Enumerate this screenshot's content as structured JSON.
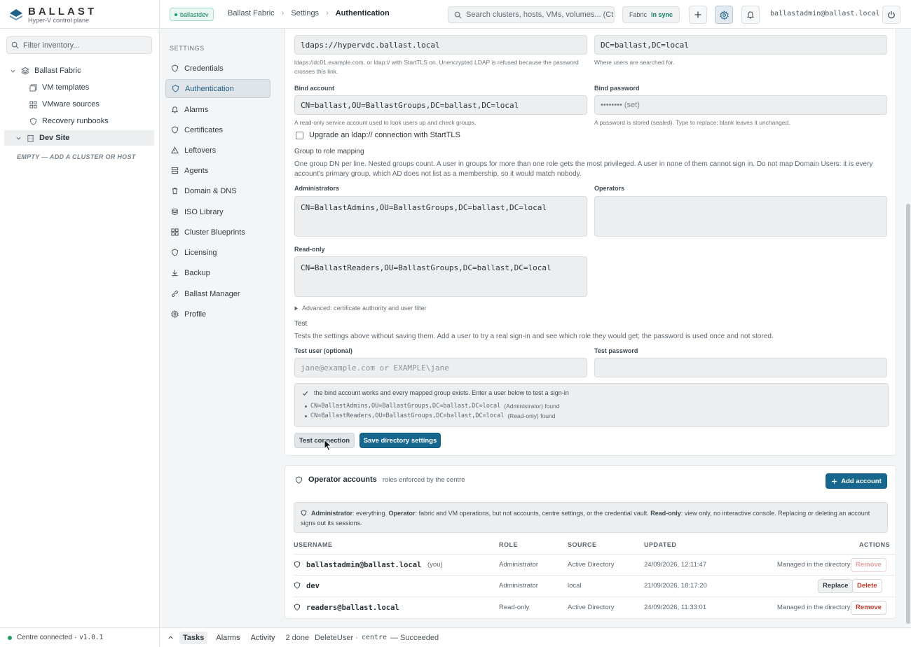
{
  "brand": {
    "name": "BALLAST",
    "subtitle": "Hyper-V control plane"
  },
  "inventory": {
    "filter_placeholder": "Filter inventory...",
    "tree": {
      "fabric": "Ballast Fabric",
      "vm_templates": "VM templates",
      "vmware_sources": "VMware sources",
      "recovery_runbooks": "Recovery runbooks",
      "dev_site": "Dev Site",
      "empty_hint": "EMPTY — ADD A CLUSTER OR HOST"
    },
    "footer": {
      "status": "Centre connected ·",
      "version": "v1.0.1"
    }
  },
  "topbar": {
    "site_badge": "ballastdev",
    "breadcrumb": [
      "Ballast Fabric",
      "Settings",
      "Authentication"
    ],
    "breadcrumb_sep": "›",
    "search_placeholder": "Search clusters, hosts, VMs, volumes... (Ctrl-K)",
    "fabric_label": "Fabric",
    "fabric_status": "In sync",
    "user": "ballastadmin@ballast.local"
  },
  "settings_nav": {
    "heading": "SETTINGS",
    "items": [
      "Credentials",
      "Authentication",
      "Alarms",
      "Certificates",
      "Leftovers",
      "Agents",
      "Domain & DNS",
      "ISO Library",
      "Cluster Blueprints",
      "Licensing",
      "Backup",
      "Ballast Manager",
      "Profile"
    ],
    "active": "Authentication"
  },
  "directory": {
    "server_value": "ldaps://hypervdc.ballast.local",
    "server_help": "ldaps://dc01.example.com, or ldap:// with StartTLS on. Unencrypted LDAP is refused because the password crosses this link.",
    "base_value": "DC=ballast,DC=local",
    "base_help": "Where users are searched for.",
    "bind_account_label": "Bind account",
    "bind_account_value": "CN=ballast,OU=BallastGroups,DC=ballast,DC=local",
    "bind_account_help": "A read-only service account used to look users up and check groups.",
    "bind_password_label": "Bind password",
    "bind_password_value": "•••••••• (set)",
    "bind_password_help": "A password is stored (sealed). Type to replace; blank leaves it unchanged.",
    "starttls_label": "Upgrade an ldap:// connection with StartTLS",
    "mapping_title": "Group to role mapping",
    "mapping_help": "One group DN per line. Nested groups count. A user in groups for more than one role gets the most privileged. A user in none of them cannot sign in. Do not map Domain Users: it is every account's primary group, which AD does not list as a membership, so it would match nobody.",
    "administrators_label": "Administrators",
    "administrators_value": "CN=BallastAdmins,OU=BallastGroups,DC=ballast,DC=local",
    "operators_label": "Operators",
    "operators_value": "",
    "readonly_label": "Read-only",
    "readonly_value": "CN=BallastReaders,OU=BallastGroups,DC=ballast,DC=local",
    "advanced_label": "Advanced: certificate authority and user filter",
    "test_title": "Test",
    "test_help": "Tests the settings above without saving them. Add a user to try a real sign-in and see which role they would get; the password is used once and not stored.",
    "test_user_label": "Test user (optional)",
    "test_user_placeholder": "jane@example.com or EXAMPLE\\jane",
    "test_password_label": "Test password",
    "result_summary": "the bind account works and every mapped group exists. Enter a user below to test a sign-in",
    "result_items": [
      {
        "dn": "CN=BallastAdmins,OU=BallastGroups,DC=ballast,DC=local",
        "note": "(Administrator) found"
      },
      {
        "dn": "CN=BallastReaders,OU=BallastGroups,DC=ballast,DC=local",
        "note": "(Read-only) found"
      }
    ],
    "test_button": "Test connection",
    "save_button": "Save directory settings"
  },
  "accounts": {
    "title": "Operator accounts",
    "subtitle": "roles enforced by the centre",
    "add_button": "Add account",
    "info_admin": "Administrator",
    "info_admin_text": ": everything. ",
    "info_operator": "Operator",
    "info_operator_text": ": fabric and VM operations, but not accounts, centre settings, or the credential vault. ",
    "info_readonly": "Read-only",
    "info_readonly_text": ": view only, no interactive console. Replacing or deleting an account signs out its sessions.",
    "columns": [
      "USERNAME",
      "ROLE",
      "SOURCE",
      "UPDATED",
      "ACTIONS"
    ],
    "rows": [
      {
        "username": "ballastadmin@ballast.local",
        "you": "(you)",
        "role": "Administrator",
        "source": "Active Directory",
        "updated": "24/09/2026, 12:11:47",
        "managed": "Managed in the directory",
        "action": "Remove"
      },
      {
        "username": "dev",
        "you": "",
        "role": "Administrator",
        "source": "local",
        "updated": "21/09/2026, 18:17:20",
        "replace": "Replace",
        "delete": "Delete"
      },
      {
        "username": "readers@ballast.local",
        "you": "",
        "role": "Read-only",
        "source": "Active Directory",
        "updated": "24/09/2026, 11:33:01",
        "managed": "Managed in the directory",
        "action": "Remove"
      }
    ]
  },
  "bottombar": {
    "tabs": [
      "Tasks",
      "Alarms",
      "Activity"
    ],
    "done": "2 done",
    "last_task_name": "DeleteUser ·",
    "last_task_target": "centre",
    "last_task_result": "— Succeeded"
  },
  "colors": {
    "accent": "#17668e",
    "success": "#12815b",
    "danger": "#c0392b"
  }
}
